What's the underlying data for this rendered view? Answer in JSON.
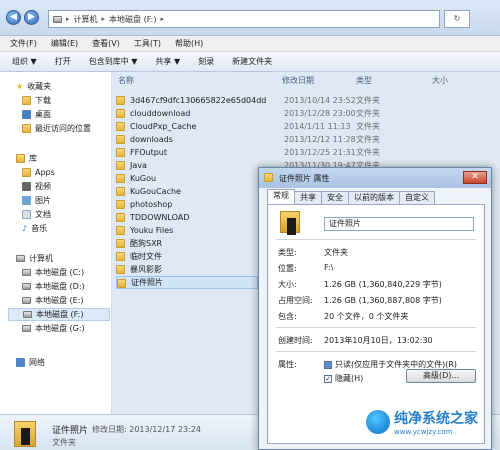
{
  "address": {
    "crumbs": [
      "计算机",
      "本地磁盘 (F:)"
    ]
  },
  "menu": [
    "文件(F)",
    "编辑(E)",
    "查看(V)",
    "工具(T)",
    "帮助(H)"
  ],
  "toolbar": [
    "组织 ▼",
    "打开",
    "包含到库中 ▼",
    "共享 ▼",
    "刻录",
    "新建文件夹"
  ],
  "nav": {
    "fav": "收藏夹",
    "download": "下载",
    "desktop": "桌面",
    "recent": "最近访问的位置",
    "lib": "库",
    "apps": "Apps",
    "video": "视频",
    "pic": "图片",
    "doc": "文档",
    "music": "音乐",
    "computer": "计算机",
    "c": "本地磁盘 (C:)",
    "d": "本地磁盘 (D:)",
    "e": "本地磁盘 (E:)",
    "f": "本地磁盘 (F:)",
    "g": "本地磁盘 (G:)",
    "net": "网络"
  },
  "columns": {
    "name": "名称",
    "date": "修改日期",
    "type": "类型",
    "size": "大小"
  },
  "files": [
    {
      "name": "3d467cf9dfc130665822e65d04dd",
      "date": "2013/10/14 23:52",
      "type": "文件夹"
    },
    {
      "name": "clouddownload",
      "date": "2013/12/28 23:00",
      "type": "文件夹"
    },
    {
      "name": "CloudPxp_Cache",
      "date": "2014/1/11 11:13",
      "type": "文件夹"
    },
    {
      "name": "downloads",
      "date": "2013/12/12 11:28",
      "type": "文件夹"
    },
    {
      "name": "FFOutput",
      "date": "2013/12/25 21:31",
      "type": "文件夹"
    },
    {
      "name": "Java",
      "date": "2013/11/30 19:47",
      "type": "文件夹"
    },
    {
      "name": "KuGou",
      "date": "",
      "type": ""
    },
    {
      "name": "KuGouCache",
      "date": "",
      "type": ""
    },
    {
      "name": "photoshop",
      "date": "",
      "type": ""
    },
    {
      "name": "TDDOWNLOAD",
      "date": "",
      "type": ""
    },
    {
      "name": "Youku Files",
      "date": "",
      "type": ""
    },
    {
      "name": "酷狗SXR",
      "date": "",
      "type": ""
    },
    {
      "name": "临时文件",
      "date": "",
      "type": ""
    },
    {
      "name": "暴风影影",
      "date": "",
      "type": ""
    },
    {
      "name": "证件照片",
      "date": "",
      "type": ""
    }
  ],
  "details": {
    "name": "证件照片",
    "meta": "修改日期: 2013/12/17 23:24",
    "type": "文件夹"
  },
  "dialog": {
    "title": "证件照片 属性",
    "tabs": [
      "常规",
      "共享",
      "安全",
      "以前的版本",
      "自定义"
    ],
    "folder_name": "证件照片",
    "type_label": "类型:",
    "type_value": "文件夹",
    "loc_label": "位置:",
    "loc_value": "F:\\",
    "size_label": "大小:",
    "size_value": "1.26 GB (1,360,840,229 字节)",
    "disk_label": "占用空间:",
    "disk_value": "1.26 GB (1,360,887,808 字节)",
    "contains_label": "包含:",
    "contains_value": "20 个文件，0 个文件夹",
    "created_label": "创建时间:",
    "created_value": "2013年10月10日，13:02:30",
    "attr_label": "属性:",
    "readonly": "只读(仅应用于文件夹中的文件)(R)",
    "hidden": "隐藏(H)",
    "advanced": "高级(D)..."
  },
  "watermark": {
    "text": "纯净系统之家",
    "url": "www.ycwjzy.com"
  }
}
